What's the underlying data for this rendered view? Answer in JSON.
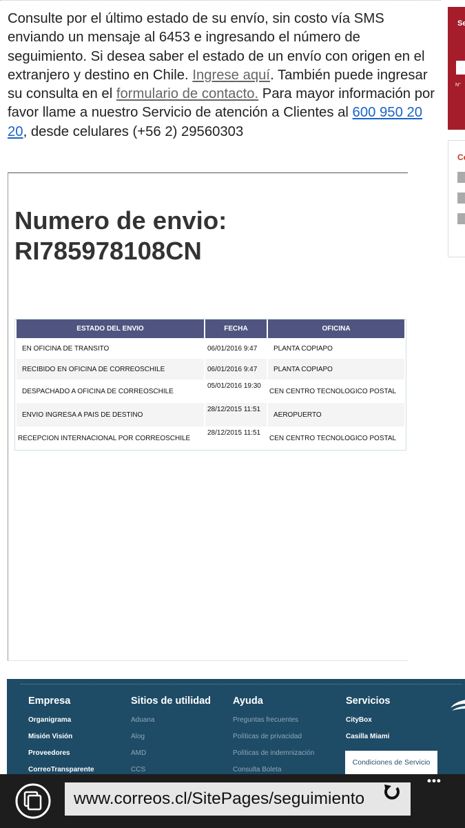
{
  "intro": {
    "t1": "Consulte por el último estado de su envío, sin costo vía SMS enviando un mensaje al 6453 e ingresando el número de seguimiento. Si desea saber el estado de un envío con origen en el extranjero y destino en Chile. ",
    "link1": "Ingrese aquí",
    "t2": ". También puede ingresar su consulta en el ",
    "link2": "formulario de contacto.",
    "t3": " Para mayor información por favor llame a nuestro Servicio de atención a Clientes al ",
    "phone": "600 950 20 20",
    "t4": ", desde celulares (+56 2) 29560303"
  },
  "tracking": {
    "title_line1": "Numero de envio:",
    "title_line2": "RI785978108CN"
  },
  "table": {
    "headers": [
      "ESTADO DEL ENVIO",
      "FECHA",
      "OFICINA"
    ],
    "rows": [
      {
        "estado": "EN OFICINA DE TRANSITO",
        "fecha": "06/01/2016 9:47",
        "oficina": "PLANTA COPIAPO"
      },
      {
        "estado": "RECIBIDO EN OFICINA DE CORREOSCHILE",
        "fecha": "06/01/2016 9:47",
        "oficina": "PLANTA COPIAPO"
      },
      {
        "estado": "DESPACHADO A OFICINA DE CORREOSCHILE",
        "fecha": "05/01/2016 19:30",
        "oficina": "CEN CENTRO TECNOLOGICO POSTAL"
      },
      {
        "estado": "ENVIO INGRESA A PAIS DE DESTINO",
        "fecha": "28/12/2015 11:51",
        "oficina": "AEROPUERTO"
      },
      {
        "estado": "RECEPCION INTERNACIONAL POR CORREOSCHILE",
        "fecha": "28/12/2015 11:51",
        "oficina": "CEN CENTRO TECNOLOGICO POSTAL"
      }
    ]
  },
  "sidebar": {
    "box1_title": "Se",
    "box1_field": "N°",
    "box2_title": "Co"
  },
  "footer": {
    "empresa": {
      "title": "Empresa",
      "items": [
        "Organigrama",
        "Misión Visión",
        "Proveedores",
        "CorreoTransparente"
      ]
    },
    "sitios": {
      "title": "Sitios de utilidad",
      "items": [
        "Aduana",
        "Alog",
        "AMD",
        "CCS"
      ]
    },
    "ayuda": {
      "title": "Ayuda",
      "items": [
        "Preguntas frecuentes",
        "Políticas de privacidad",
        "Políticas de indemnización",
        "Consulta Boleta"
      ]
    },
    "servicios": {
      "title": "Servicios",
      "items": [
        "CityBox",
        "Casilla Miami"
      ]
    },
    "condiciones": "Condiciones de Servicio"
  },
  "browser": {
    "url": "www.correos.cl/SitePages/seguimiento",
    "more": "•••"
  },
  "colors": {
    "table_header": "#4f5580",
    "footer_bg": "#1e4b66",
    "sidebar_red": "#a51d2b",
    "link_blue": "#1a63c7"
  }
}
